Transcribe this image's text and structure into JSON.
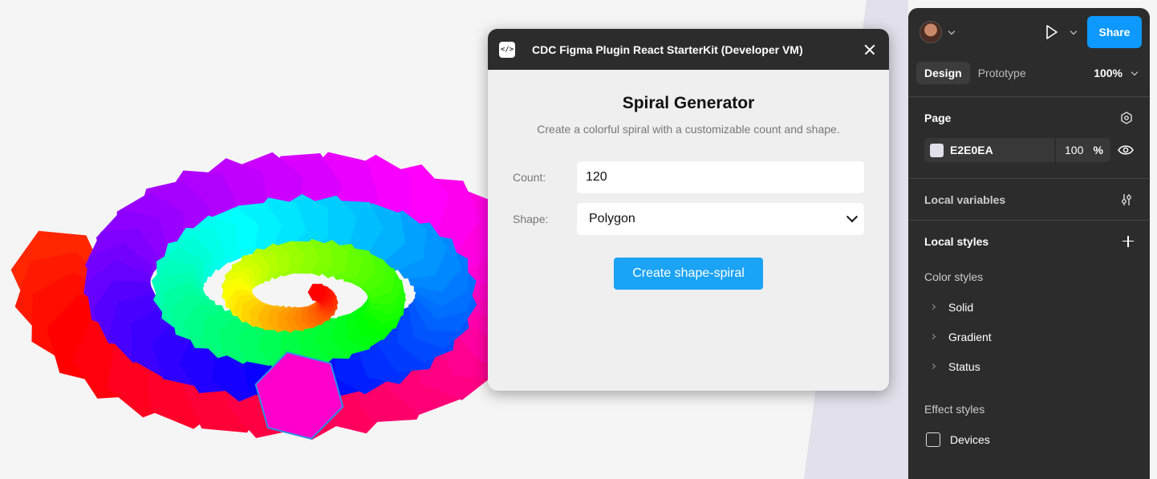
{
  "plugin": {
    "icon_text": "</>",
    "window_title": "CDC Figma Plugin React StarterKit (Developer VM)",
    "heading": "Spiral Generator",
    "subtitle": "Create a colorful spiral with a customizable count and shape.",
    "count_label": "Count:",
    "count_value": "120",
    "shape_label": "Shape:",
    "shape_value": "Polygon",
    "create_button": "Create shape-spiral"
  },
  "right_panel": {
    "share_label": "Share",
    "tabs": [
      "Design",
      "Prototype"
    ],
    "active_tab": "Design",
    "zoom": "100%",
    "page": {
      "title": "Page",
      "color_hex": "E2E0EA",
      "opacity": "100",
      "opacity_unit": "%"
    },
    "local_variables": "Local variables",
    "local_styles": "Local styles",
    "color_styles": {
      "title": "Color styles",
      "items": [
        "Solid",
        "Gradient",
        "Status"
      ]
    },
    "effect_styles": {
      "title": "Effect styles",
      "items": [
        "Devices"
      ]
    }
  },
  "colors": {
    "accent": "#0d99ff",
    "plugin_button": "#1ba3f5",
    "panel_bg": "#2c2c2c",
    "page_swatch": "#e2e0ea"
  }
}
